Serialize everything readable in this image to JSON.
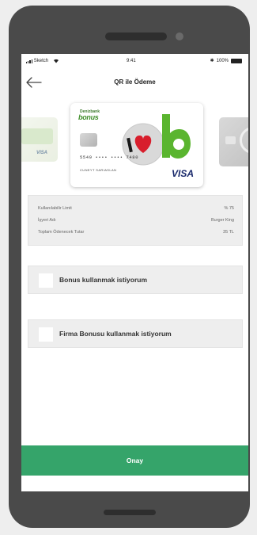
{
  "status_bar": {
    "carrier": "Sketch",
    "time": "9:41",
    "battery": "100%"
  },
  "header": {
    "title": "QR ile Ödeme"
  },
  "card": {
    "bank": "Denizbank",
    "brand": "bonus",
    "number": "5549 •••• •••• 7480",
    "holder": "CUNEYT SARIASLAN",
    "network": "VISA"
  },
  "summary": {
    "rows": [
      {
        "label": "Kullanılabilir Limit",
        "value": "% 75"
      },
      {
        "label": "İşyeri Adı",
        "value": "Burger King"
      },
      {
        "label": "Toplam Ödenecek Tutar",
        "value": "35 TL"
      }
    ]
  },
  "options": [
    {
      "label": "Bonus kullanmak istiyorum",
      "checked": false
    },
    {
      "label": "Firma Bonusu kullanmak istiyorum",
      "checked": false
    }
  ],
  "actions": {
    "confirm_label": "Onay"
  },
  "colors": {
    "accent": "#35a46a",
    "brand_green": "#3f8e2a",
    "heart": "#d81e2c"
  }
}
